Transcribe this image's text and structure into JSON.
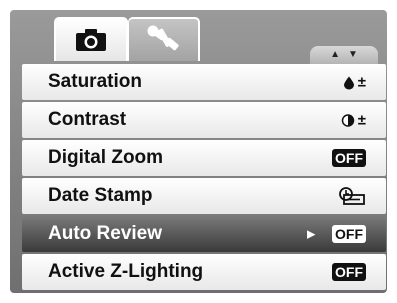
{
  "tabs": [
    {
      "icon": "camera-icon",
      "active": true
    },
    {
      "icon": "setup-wrench-icon",
      "active": false
    }
  ],
  "scroll": {
    "up": "▲",
    "down": "▼"
  },
  "menu": {
    "items": [
      {
        "label": "Saturation",
        "value_icon": "saturation-icon",
        "value_text": "±"
      },
      {
        "label": "Contrast",
        "value_icon": "contrast-icon",
        "value_text": "±"
      },
      {
        "label": "Digital Zoom",
        "value_text": "OFF"
      },
      {
        "label": "Date Stamp",
        "value_icon": "date-stamp-icon"
      },
      {
        "label": "Auto Review",
        "value_text": "OFF",
        "selected": true,
        "submenu_arrow": "▶"
      },
      {
        "label": "Active Z-Lighting",
        "value_text": "OFF"
      }
    ]
  }
}
